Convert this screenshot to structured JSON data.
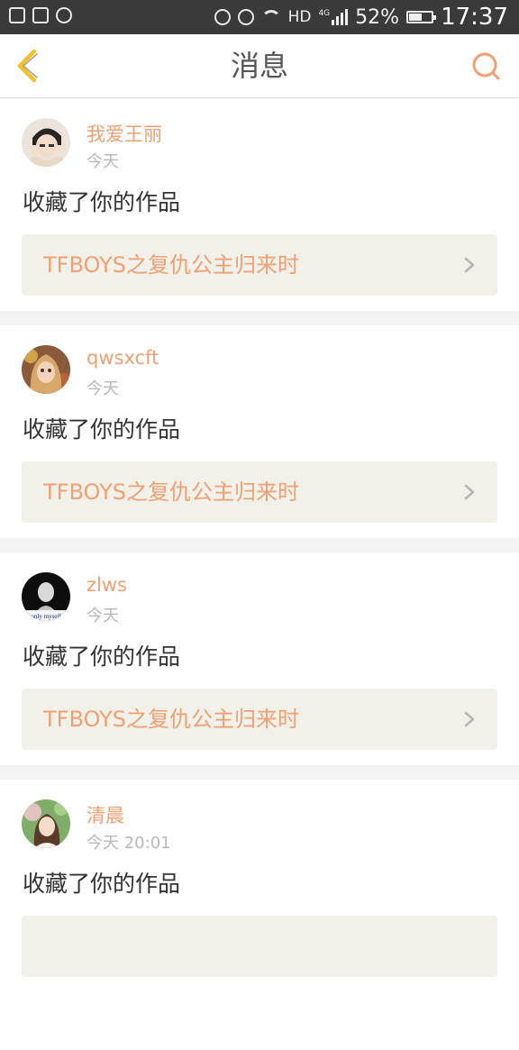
{
  "status_bar": {
    "network": "HD",
    "signal_label": "4G",
    "battery_percent": "52%",
    "battery_level": 0.52,
    "time": "17:37"
  },
  "header": {
    "title": "消息",
    "back_icon": "chevron-left-icon",
    "search_icon": "search-icon"
  },
  "colors": {
    "accent": "#f0a072",
    "back_icon": "#f3c12c",
    "card_link_bg": "#f1f1ea"
  },
  "messages": [
    {
      "name": "我爱王丽",
      "date": "今天",
      "action": "收藏了你的作品",
      "work_title": "TFBOYS之复仇公主归来时"
    },
    {
      "name": "qwsxcft",
      "date": "今天",
      "action": "收藏了你的作品",
      "work_title": "TFBOYS之复仇公主归来时"
    },
    {
      "name": "zlws",
      "date": "今天",
      "action": "收藏了你的作品",
      "work_title": "TFBOYS之复仇公主归来时",
      "avatar_caption": "only myself"
    },
    {
      "name": "清晨",
      "date": "今天 20:01",
      "action": "收藏了你的作品"
    }
  ]
}
